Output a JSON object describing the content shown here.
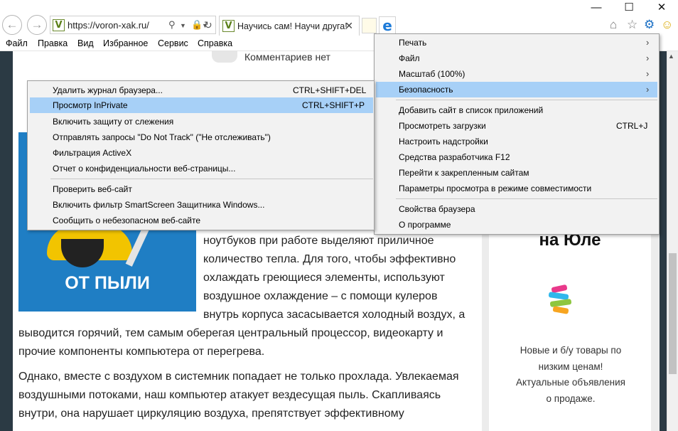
{
  "browser": {
    "url": "https://voron-xak.ru/",
    "tab_title": "Научись сам! Научи друга!",
    "favicon_letter": "V",
    "window": {
      "minimize": "—",
      "maximize": "☐",
      "close": "✕"
    }
  },
  "menubar": [
    "Файл",
    "Правка",
    "Вид",
    "Избранное",
    "Сервис",
    "Справка"
  ],
  "tools_menu": [
    {
      "label": "Печать",
      "arrow": "›"
    },
    {
      "label": "Файл",
      "arrow": "›"
    },
    {
      "label": "Масштаб (100%)",
      "arrow": "›"
    },
    {
      "label": "Безопасность",
      "arrow": "›",
      "highlight": true
    },
    {
      "label": "Добавить сайт в список приложений"
    },
    {
      "label": "Просмотреть загрузки",
      "shortcut": "CTRL+J"
    },
    {
      "label": "Настроить надстройки"
    },
    {
      "label": "Средства разработчика F12"
    },
    {
      "label": "Перейти к закрепленным сайтам"
    },
    {
      "label": "Параметры просмотра в режиме совместимости"
    },
    {
      "label": "Свойства браузера"
    },
    {
      "label": "О программе"
    }
  ],
  "safety_menu": [
    {
      "label": "Удалить журнал браузера...",
      "shortcut": "CTRL+SHIFT+DEL"
    },
    {
      "label": "Просмотр InPrivate",
      "shortcut": "CTRL+SHIFT+P",
      "highlight": true
    },
    {
      "label": "Включить защиту от слежения"
    },
    {
      "label": "Отправлять запросы \"Do Not Track\" (\"Не отслеживать\")"
    },
    {
      "label": "Фильтрация ActiveX"
    },
    {
      "label": "Отчет о конфиденциальности веб-страницы..."
    },
    {
      "label": "Проверить веб-сайт"
    },
    {
      "label": "Включить фильтр SmartScreen Защитника Windows..."
    },
    {
      "label": "Сообщить о небезопасном веб-сайте"
    }
  ],
  "page": {
    "comments": "Комментариев нет",
    "thumb_caption": "ОТ ПЫЛИ",
    "para1_lines": [
      "ноутбуков при работе выделяют приличное",
      "количество тепла. Для того, чтобы эффективно",
      "охлаждать греющиеся элементы, используют",
      "воздушное охлаждение – с помощи кулеров",
      "внутрь корпуса засасывается холодный воздух, а",
      "выводится горячий, тем самым оберегая центральный процессор, видеокарту и",
      "прочие компоненты компьютера от перегрева."
    ],
    "para2_lines": [
      "Однако, вместе с воздухом в системник попадает не только прохлада. Увлекаемая",
      "воздушными потоками, наш компьютер атакует вездесущая пыль. Скапливаясь",
      "внутри, она нарушает циркуляцию воздуха, препятствует эффективному"
    ],
    "ad": {
      "title": "на Юле",
      "lines": [
        "Новые и б/у товары по",
        "низким ценам!",
        "Актуальные объявления",
        "о продаже."
      ]
    }
  }
}
